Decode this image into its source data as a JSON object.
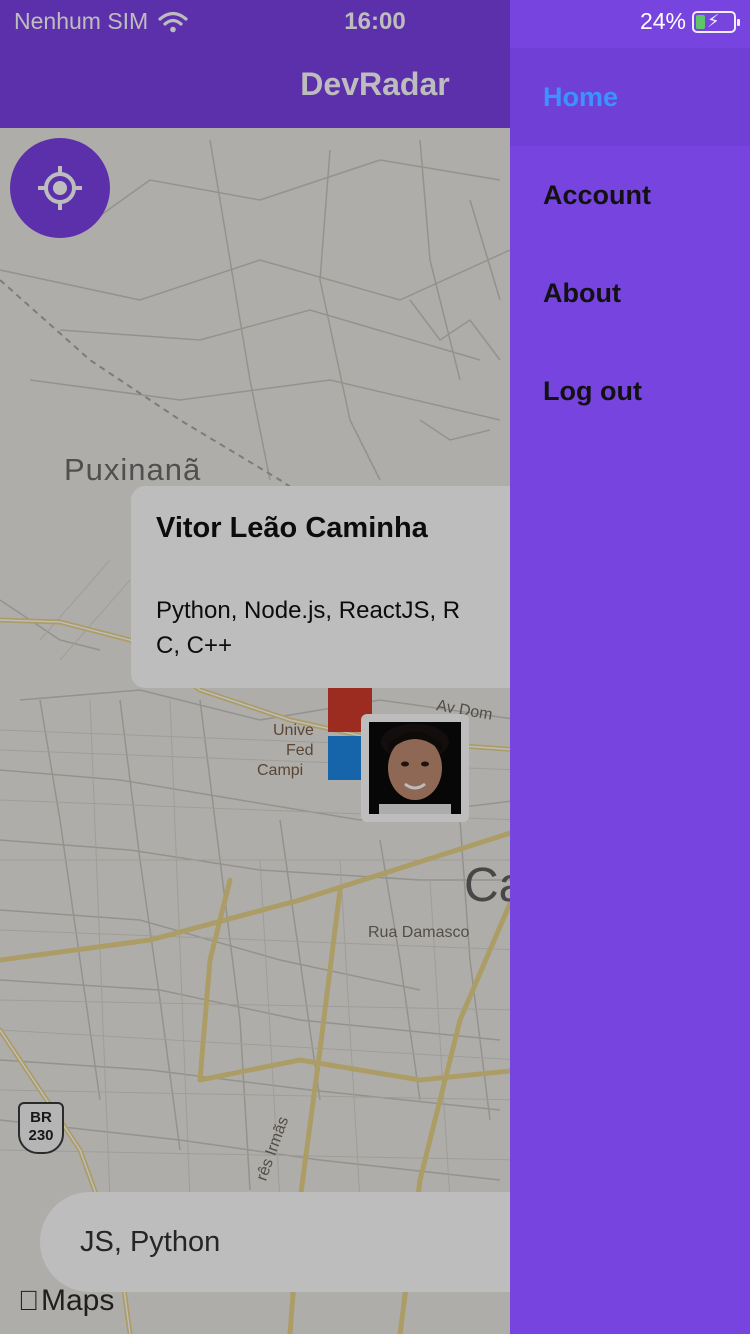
{
  "status_bar": {
    "carrier": "Nenhum SIM",
    "time": "16:00",
    "battery": "24%",
    "battery_level": 0.24
  },
  "header": {
    "title": "DevRadar"
  },
  "map": {
    "city_label": "Puxinanã",
    "street_labels": {
      "av_dom": "Av Dom",
      "rua_damasco": "Rua Damasco",
      "tres_irmas": "rês Irmãs",
      "univ_1": "Unive",
      "univ_2": "Fed",
      "univ_3": "Campi"
    },
    "big_letters": "Ca",
    "highway": {
      "top": "BR",
      "bottom": "230"
    },
    "attribution": "Maps"
  },
  "callout": {
    "name": "Vitor Leão Caminha",
    "techs": "Python, Node.js, ReactJS, R\nC, C++"
  },
  "search": {
    "value": "JS, Python"
  },
  "drawer": {
    "items": [
      {
        "label": "Home",
        "active": true
      },
      {
        "label": "Account",
        "active": false
      },
      {
        "label": "About",
        "active": false
      },
      {
        "label": "Log out",
        "active": false
      }
    ]
  },
  "icons": {
    "locate": "crosshair-icon",
    "wifi": "wifi-icon",
    "battery": "battery-icon",
    "apple": "apple-icon"
  },
  "colors": {
    "brand": "#7d40e7",
    "drawer_bg": "#7744e0",
    "active_text": "#3b93ff"
  }
}
